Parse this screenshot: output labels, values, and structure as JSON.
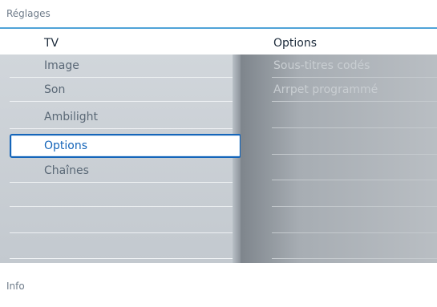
{
  "window": {
    "title": "Réglages"
  },
  "header": {
    "left": "TV",
    "right": "Options"
  },
  "menu": {
    "items": [
      {
        "label": "Image",
        "selected": false
      },
      {
        "label": "Son",
        "selected": false
      },
      {
        "label": "Ambilight",
        "selected": false
      },
      {
        "label": "Options",
        "selected": true
      },
      {
        "label": "Chaînes",
        "selected": false
      },
      {
        "label": "",
        "selected": false
      },
      {
        "label": "",
        "selected": false
      },
      {
        "label": "",
        "selected": false
      }
    ]
  },
  "options": {
    "items": [
      {
        "label": "Sous-titres codés"
      },
      {
        "label": "Arrpet programmé"
      },
      {
        "label": ""
      },
      {
        "label": ""
      },
      {
        "label": ""
      },
      {
        "label": ""
      },
      {
        "label": ""
      },
      {
        "label": ""
      }
    ]
  },
  "footer": {
    "info": "Info"
  },
  "colors": {
    "accent": "#1565b9",
    "title_line": "#4fa3d8"
  }
}
